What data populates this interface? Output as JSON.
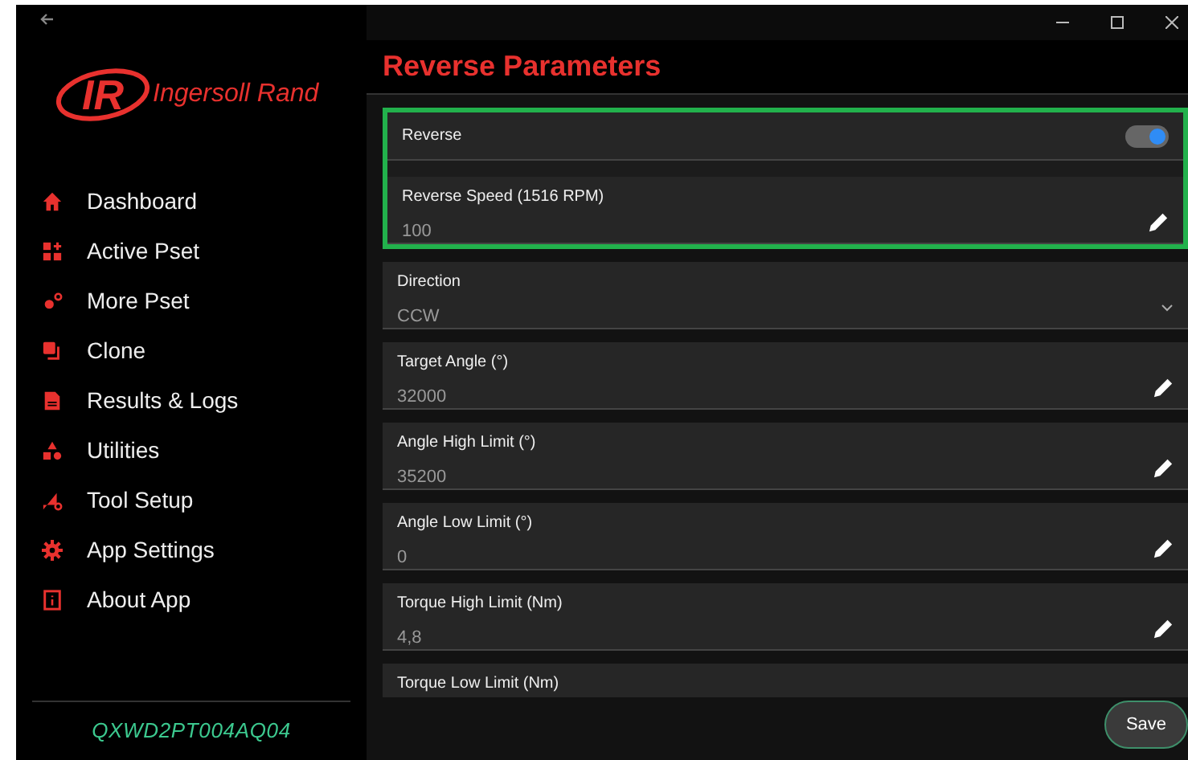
{
  "sidebar": {
    "logo": {
      "mark": "IR",
      "name": "Ingersoll Rand"
    },
    "items": [
      {
        "label": "Dashboard",
        "kind": "home"
      },
      {
        "label": "Active Pset",
        "kind": "grid"
      },
      {
        "label": "More Pset",
        "kind": "gears"
      },
      {
        "label": "Clone",
        "kind": "copy"
      },
      {
        "label": "Results & Logs",
        "kind": "doc"
      },
      {
        "label": "Utilities",
        "kind": "shapes"
      },
      {
        "label": "Tool Setup",
        "kind": "tool"
      },
      {
        "label": "App Settings",
        "kind": "gear"
      },
      {
        "label": "About App",
        "kind": "info"
      }
    ],
    "serial": "QXWD2PT004AQ04"
  },
  "title": "Reverse Parameters",
  "fields": [
    {
      "kind": "toggle",
      "label": "Reverse",
      "on": true,
      "highlighted": true
    },
    {
      "kind": "text",
      "label": "Reverse Speed (1516 RPM)",
      "value": "100",
      "highlighted": true
    },
    {
      "kind": "dropdown",
      "label": "Direction",
      "value": "CCW",
      "highlighted": false
    },
    {
      "kind": "text",
      "label": "Target Angle (°)",
      "value": "32000",
      "highlighted": false
    },
    {
      "kind": "text",
      "label": "Angle High Limit (°)",
      "value": "35200",
      "highlighted": false
    },
    {
      "kind": "text",
      "label": "Angle Low Limit (°)",
      "value": "0",
      "highlighted": false
    },
    {
      "kind": "text",
      "label": "Torque High Limit (Nm)",
      "value": "4,8",
      "highlighted": false
    },
    {
      "kind": "text",
      "label": "Torque Low Limit (Nm)",
      "highlighted": false
    }
  ],
  "save_button": "Save"
}
